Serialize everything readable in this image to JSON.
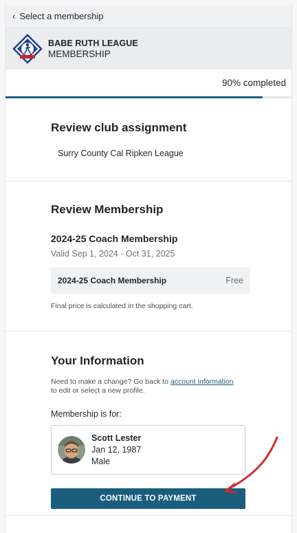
{
  "nav": {
    "back_label": "Select a membership"
  },
  "league": {
    "name": "BABE RUTH LEAGUE",
    "subtitle": "MEMBERSHIP"
  },
  "progress": {
    "text": "90% completed",
    "value": 0.9
  },
  "club": {
    "heading": "Review club assignment",
    "name": "Surry County Cal Ripken League"
  },
  "membership": {
    "heading": "Review Membership",
    "name": "2024-25 Coach Membership",
    "validity": "Valid Sep 1, 2024 - Oct 31, 2025",
    "price_item": "2024-25 Coach Membership",
    "price_value": "Free",
    "note": "Final price is calculated in the shopping cart."
  },
  "info": {
    "heading": "Your Information",
    "change_prefix": "Need to make a change? Go back to ",
    "change_link": "account information",
    "change_suffix": "to edit or select a new profile.",
    "for_label": "Membership is for:",
    "person": {
      "name": "Scott Lester",
      "dob": "Jan 12, 1987",
      "gender": "Male"
    },
    "continue_label": "CONTINUE TO PAYMENT"
  },
  "colors": {
    "accent": "#1a5e7e",
    "annotation": "#d32f2f"
  }
}
